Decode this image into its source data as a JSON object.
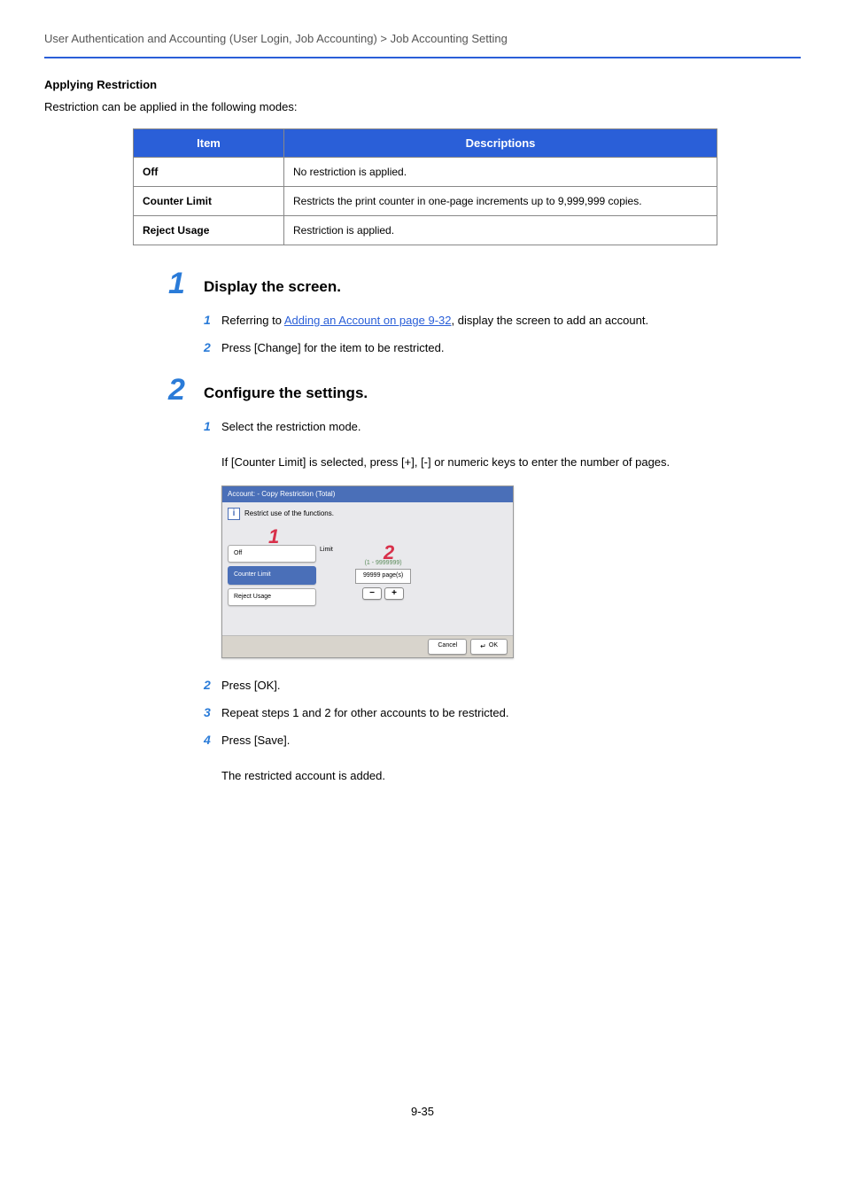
{
  "breadcrumb": "User Authentication and Accounting (User Login, Job Accounting) > Job Accounting Setting",
  "section_heading": "Applying Restriction",
  "intro_text": "Restriction can be applied in the following modes:",
  "table": {
    "headers": {
      "col1": "Item",
      "col2": "Descriptions"
    },
    "rows": [
      {
        "item": "Off",
        "desc": "No restriction is applied."
      },
      {
        "item": "Counter Limit",
        "desc": "Restricts the print counter in one-page increments up to 9,999,999 copies."
      },
      {
        "item": "Reject Usage",
        "desc": "Restriction is applied."
      }
    ]
  },
  "step1": {
    "num": "1",
    "title": "Display the screen.",
    "subs": {
      "s1": {
        "num": "1",
        "before": "Referring to ",
        "link": "Adding an Account on page 9-32",
        "after": ", display the screen to add an account."
      },
      "s2": {
        "num": "2",
        "text": "Press [Change] for the item to be restricted."
      }
    }
  },
  "step2": {
    "num": "2",
    "title": "Configure the settings.",
    "subs": {
      "s1": {
        "num": "1",
        "text": "Select the restriction mode."
      },
      "s1_detail": "If [Counter Limit] is selected, press [+], [-] or numeric keys to enter the number of pages.",
      "s2": {
        "num": "2",
        "text": "Press [OK]."
      },
      "s3": {
        "num": "3",
        "text": "Repeat steps 1 and 2 for other accounts to be restricted."
      },
      "s4": {
        "num": "4",
        "text": "Press [Save]."
      },
      "s4_detail": "The restricted account is added."
    }
  },
  "dialog": {
    "title": "Account:  - Copy Restriction (Total)",
    "info_text": "Restrict use of the functions.",
    "info_glyph": "i",
    "callouts": {
      "c1": "1",
      "c2": "2"
    },
    "options": {
      "off": "Off",
      "counter": "Counter Limit",
      "reject": "Reject Usage"
    },
    "limit": {
      "label": "Limit",
      "range": "(1 - 9999999)",
      "value": "99999",
      "unit": "page(s)",
      "minus": "−",
      "plus": "+"
    },
    "buttons": {
      "cancel": "Cancel",
      "ok": "OK",
      "enter_glyph": "↵"
    }
  },
  "page_number": "9-35"
}
